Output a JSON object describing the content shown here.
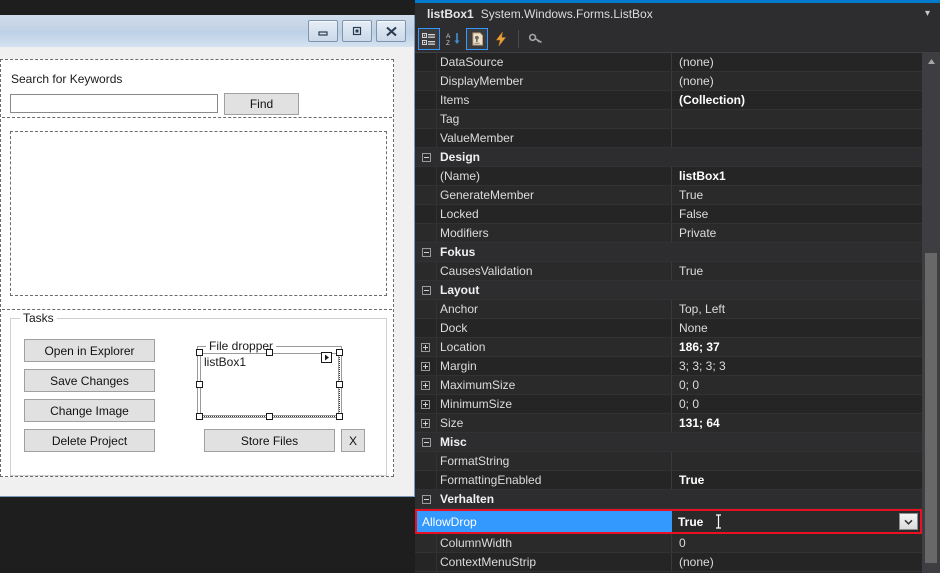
{
  "form": {
    "window_buttons": [
      {
        "name": "minimize-button",
        "glyph": "minimize"
      },
      {
        "name": "maximize-button",
        "glyph": "maximize"
      },
      {
        "name": "close-button",
        "glyph": "close"
      }
    ],
    "search": {
      "label": "Search for Keywords",
      "value": "",
      "placeholder": "",
      "find_button": "Find"
    },
    "tasks": {
      "legend": "Tasks",
      "buttons": [
        "Open in Explorer",
        "Save Changes",
        "Change Image",
        "Delete Project"
      ]
    },
    "dropper": {
      "legend": "File dropper",
      "listbox_item": "listBox1",
      "store_files_button": "Store Files",
      "clear_button": "X"
    }
  },
  "properties_pane": {
    "object_name": "listBox1",
    "object_type": "System.Windows.Forms.ListBox",
    "header_caret": "▾",
    "toolbar": [
      {
        "name": "categorized-view-button",
        "state": "active"
      },
      {
        "name": "alphabetical-sort-button",
        "state": "normal"
      },
      {
        "name": "properties-page-button",
        "state": "active"
      },
      {
        "name": "events-button",
        "state": "normal"
      },
      {
        "name": "property-pages-key-button",
        "state": "normal"
      }
    ],
    "accent_color": "#007acc",
    "selection_color": "#3399ff",
    "highlight_border_color": "#e81123",
    "rows": [
      {
        "expander": "none",
        "name": "DataSource",
        "value": "(none)",
        "bold": false,
        "category": false
      },
      {
        "expander": "none",
        "name": "DisplayMember",
        "value": "(none)",
        "bold": false,
        "category": false
      },
      {
        "expander": "none",
        "name": "Items",
        "value": "(Collection)",
        "bold": true,
        "category": false
      },
      {
        "expander": "none",
        "name": "Tag",
        "value": "",
        "bold": false,
        "category": false
      },
      {
        "expander": "none",
        "name": "ValueMember",
        "value": "",
        "bold": false,
        "category": false
      },
      {
        "expander": "minus",
        "name": "Design",
        "value": "",
        "bold": false,
        "category": true
      },
      {
        "expander": "none",
        "name": "(Name)",
        "value": "listBox1",
        "bold": true,
        "category": false
      },
      {
        "expander": "none",
        "name": "GenerateMember",
        "value": "True",
        "bold": false,
        "category": false
      },
      {
        "expander": "none",
        "name": "Locked",
        "value": "False",
        "bold": false,
        "category": false
      },
      {
        "expander": "none",
        "name": "Modifiers",
        "value": "Private",
        "bold": false,
        "category": false
      },
      {
        "expander": "minus",
        "name": "Fokus",
        "value": "",
        "bold": false,
        "category": true
      },
      {
        "expander": "none",
        "name": "CausesValidation",
        "value": "True",
        "bold": false,
        "category": false
      },
      {
        "expander": "minus",
        "name": "Layout",
        "value": "",
        "bold": false,
        "category": true
      },
      {
        "expander": "none",
        "name": "Anchor",
        "value": "Top, Left",
        "bold": false,
        "category": false
      },
      {
        "expander": "none",
        "name": "Dock",
        "value": "None",
        "bold": false,
        "category": false
      },
      {
        "expander": "plus",
        "name": "Location",
        "value": "186; 37",
        "bold": true,
        "category": false
      },
      {
        "expander": "plus",
        "name": "Margin",
        "value": "3; 3; 3; 3",
        "bold": false,
        "category": false
      },
      {
        "expander": "plus",
        "name": "MaximumSize",
        "value": "0; 0",
        "bold": false,
        "category": false
      },
      {
        "expander": "plus",
        "name": "MinimumSize",
        "value": "0; 0",
        "bold": false,
        "category": false
      },
      {
        "expander": "plus",
        "name": "Size",
        "value": "131; 64",
        "bold": true,
        "category": false
      },
      {
        "expander": "minus",
        "name": "Misc",
        "value": "",
        "bold": false,
        "category": true
      },
      {
        "expander": "none",
        "name": "FormatString",
        "value": "",
        "bold": false,
        "category": false
      },
      {
        "expander": "none",
        "name": "FormattingEnabled",
        "value": "True",
        "bold": true,
        "category": false
      },
      {
        "expander": "minus",
        "name": "Verhalten",
        "value": "",
        "bold": false,
        "category": true
      }
    ],
    "selected_row": {
      "name": "AllowDrop",
      "value": "True"
    },
    "rows_after": [
      {
        "expander": "none",
        "name": "ColumnWidth",
        "value": "0",
        "bold": false,
        "category": false
      },
      {
        "expander": "none",
        "name": "ContextMenuStrip",
        "value": "(none)",
        "bold": false,
        "category": false
      }
    ]
  }
}
